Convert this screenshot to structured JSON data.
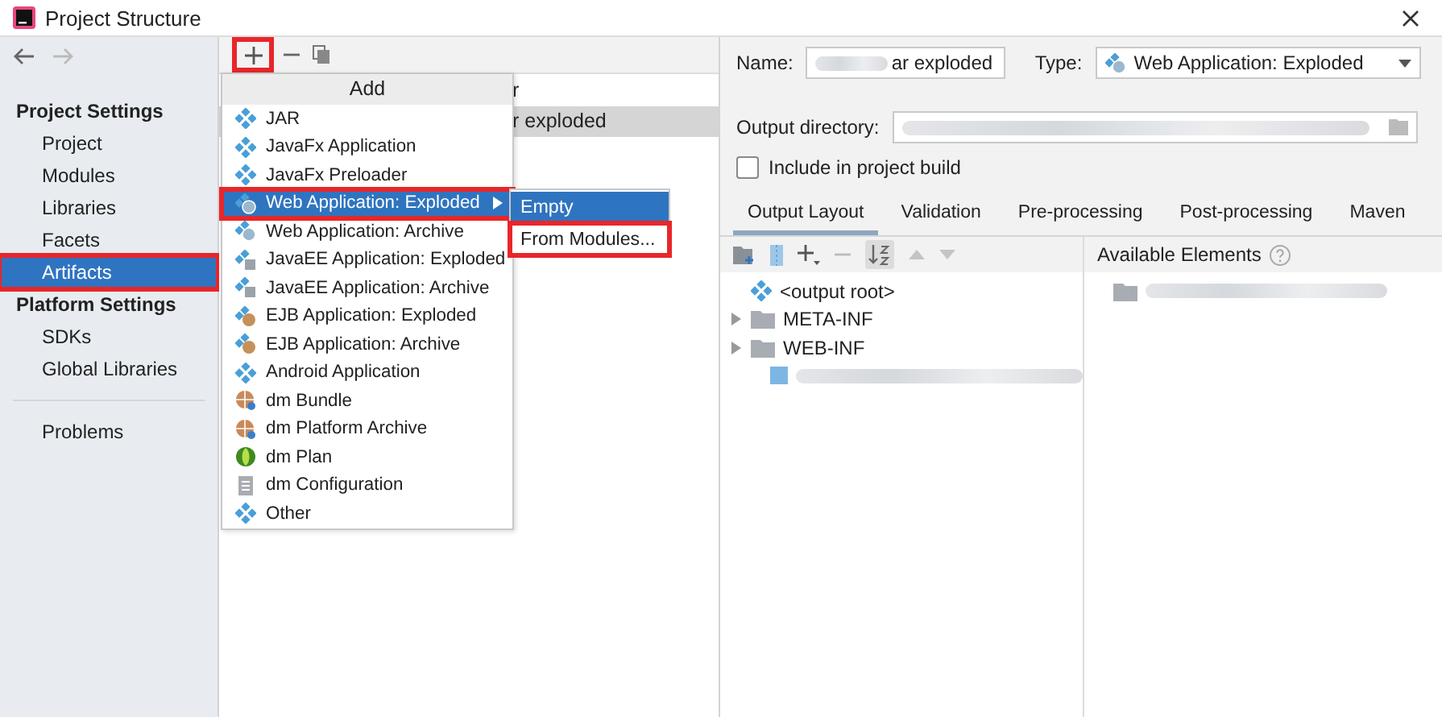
{
  "window": {
    "title": "Project Structure"
  },
  "sidebar": {
    "sections": [
      {
        "heading": "Project Settings",
        "items": [
          {
            "label": "Project",
            "selected": false,
            "highlighted": false
          },
          {
            "label": "Modules",
            "selected": false,
            "highlighted": false
          },
          {
            "label": "Libraries",
            "selected": false,
            "highlighted": false
          },
          {
            "label": "Facets",
            "selected": false,
            "highlighted": false
          },
          {
            "label": "Artifacts",
            "selected": true,
            "highlighted": true
          }
        ]
      },
      {
        "heading": "Platform Settings",
        "items": [
          {
            "label": "SDKs",
            "selected": false,
            "highlighted": false
          },
          {
            "label": "Global Libraries",
            "selected": false,
            "highlighted": false
          }
        ]
      },
      {
        "items": [
          {
            "label": "Problems",
            "selected": false,
            "highlighted": false
          }
        ]
      }
    ]
  },
  "artifacts_toolbar": {
    "add_highlighted": true
  },
  "artifacts": [
    {
      "label": "r",
      "selected": false
    },
    {
      "label": "r exploded",
      "selected": true
    }
  ],
  "add_menu": {
    "title": "Add",
    "items": [
      {
        "label": "JAR",
        "kind": "module",
        "selected": false,
        "highlighted": false,
        "submenu": false
      },
      {
        "label": "JavaFx Application",
        "kind": "module",
        "selected": false,
        "highlighted": false,
        "submenu": false
      },
      {
        "label": "JavaFx Preloader",
        "kind": "module",
        "selected": false,
        "highlighted": false,
        "submenu": false
      },
      {
        "label": "Web Application: Exploded",
        "kind": "web",
        "selected": true,
        "highlighted": true,
        "submenu": true
      },
      {
        "label": "Web Application: Archive",
        "kind": "web",
        "selected": false,
        "highlighted": false,
        "submenu": false
      },
      {
        "label": "JavaEE Application: Exploded",
        "kind": "javaee",
        "selected": false,
        "highlighted": false,
        "submenu": false
      },
      {
        "label": "JavaEE Application: Archive",
        "kind": "javaee",
        "selected": false,
        "highlighted": false,
        "submenu": false
      },
      {
        "label": "EJB Application: Exploded",
        "kind": "ejb",
        "selected": false,
        "highlighted": false,
        "submenu": false
      },
      {
        "label": "EJB Application: Archive",
        "kind": "ejb",
        "selected": false,
        "highlighted": false,
        "submenu": false
      },
      {
        "label": "Android Application",
        "kind": "module",
        "selected": false,
        "highlighted": false,
        "submenu": false
      },
      {
        "label": "dm Bundle",
        "kind": "globe",
        "selected": false,
        "highlighted": false,
        "submenu": false
      },
      {
        "label": "dm Platform Archive",
        "kind": "globe",
        "selected": false,
        "highlighted": false,
        "submenu": false
      },
      {
        "label": "dm Plan",
        "kind": "plan",
        "selected": false,
        "highlighted": false,
        "submenu": false
      },
      {
        "label": "dm Configuration",
        "kind": "config",
        "selected": false,
        "highlighted": false,
        "submenu": false
      },
      {
        "label": "Other",
        "kind": "module",
        "selected": false,
        "highlighted": false,
        "submenu": false
      }
    ]
  },
  "submenu": {
    "items": [
      {
        "label": "Empty",
        "selected": true,
        "highlighted": false
      },
      {
        "label": "From Modules...",
        "selected": false,
        "highlighted": true
      }
    ]
  },
  "editor": {
    "name_label": "Name:",
    "name_value": "ar exploded",
    "type_label": "Type:",
    "type_value": "Web Application: Exploded",
    "output_label": "Output directory:",
    "include_label": "Include in project build",
    "include_checked": false,
    "tabs": [
      {
        "label": "Output Layout",
        "selected": true
      },
      {
        "label": "Validation",
        "selected": false
      },
      {
        "label": "Pre-processing",
        "selected": false
      },
      {
        "label": "Post-processing",
        "selected": false
      },
      {
        "label": "Maven",
        "selected": false
      }
    ],
    "available_label": "Available Elements",
    "tree": [
      {
        "kind": "root",
        "label": "<output root>"
      },
      {
        "kind": "folder",
        "label": "META-INF",
        "expanded": false
      },
      {
        "kind": "folder",
        "label": "WEB-INF",
        "expanded": false
      },
      {
        "kind": "module"
      }
    ],
    "available": [
      {
        "kind": "module"
      }
    ]
  }
}
